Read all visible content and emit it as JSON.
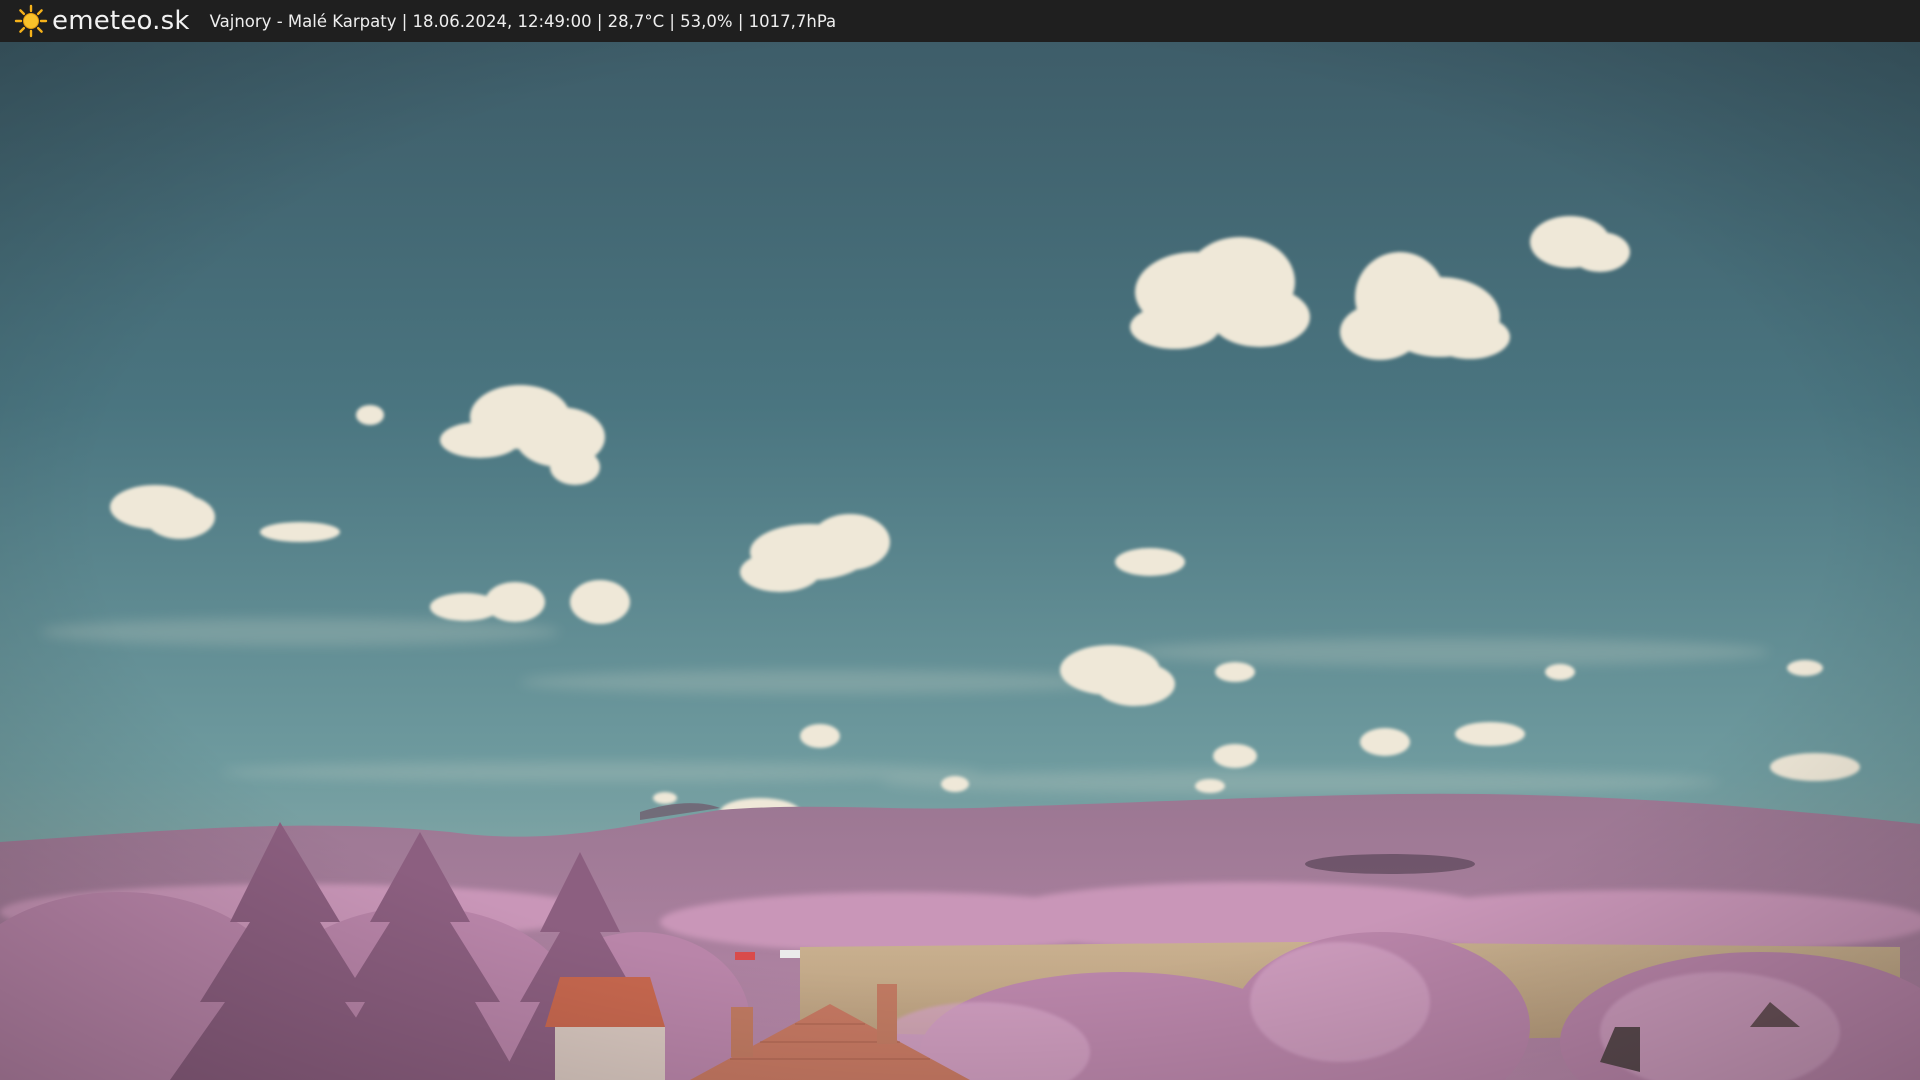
{
  "header": {
    "brand": "emeteo.sk",
    "logo_icon": "sun-icon",
    "caption": "Vajnory - Malé Karpaty | 18.06.2024, 12:49:00 | 28,7°C | 53,0% | 1017,7hPa"
  },
  "webcam": {
    "scene": "infrared sky with cumulus clouds over Malé Karpaty hills, pink vegetation and rooftops"
  },
  "colors": {
    "topbar": "#1f1f1f",
    "sky_top": "#3f5f6a",
    "sky_bottom": "#7fa7a8",
    "hills": "#a77e99",
    "vegetation": "#c78fb5",
    "roof": "#c86a55",
    "field": "#c2a98a",
    "sun": "#f6b21a"
  }
}
